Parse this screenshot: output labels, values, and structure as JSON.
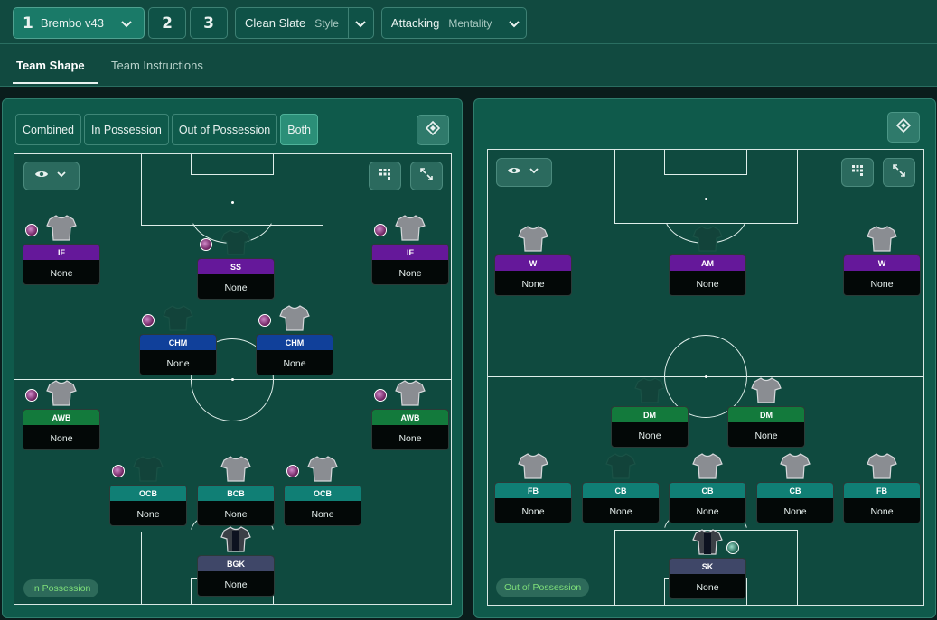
{
  "header": {
    "tactic": {
      "number": "1",
      "name": "Brembo v43"
    },
    "slots": [
      "2",
      "3"
    ],
    "style": {
      "value": "Clean Slate",
      "label": "Style"
    },
    "mentality": {
      "value": "Attacking",
      "label": "Mentality"
    },
    "tabs": [
      "Team Shape",
      "Team Instructions"
    ]
  },
  "left_panel": {
    "filters": [
      "Combined",
      "In Possession",
      "Out of Possession",
      "Both"
    ],
    "phase_label": "In Possession",
    "players": [
      {
        "role": "IF",
        "name": "None",
        "color": "purple"
      },
      {
        "role": "SS",
        "name": "None",
        "color": "purple"
      },
      {
        "role": "IF",
        "name": "None",
        "color": "purple"
      },
      {
        "role": "CHM",
        "name": "None",
        "color": "blue"
      },
      {
        "role": "CHM",
        "name": "None",
        "color": "blue"
      },
      {
        "role": "AWB",
        "name": "None",
        "color": "green"
      },
      {
        "role": "AWB",
        "name": "None",
        "color": "green"
      },
      {
        "role": "OCB",
        "name": "None",
        "color": "teal"
      },
      {
        "role": "BCB",
        "name": "None",
        "color": "teal"
      },
      {
        "role": "OCB",
        "name": "None",
        "color": "teal"
      },
      {
        "role": "BGK",
        "name": "None",
        "color": "slate"
      }
    ]
  },
  "right_panel": {
    "phase_label": "Out of Possession",
    "players": [
      {
        "role": "W",
        "name": "None",
        "color": "purple"
      },
      {
        "role": "AM",
        "name": "None",
        "color": "purple"
      },
      {
        "role": "W",
        "name": "None",
        "color": "purple"
      },
      {
        "role": "DM",
        "name": "None",
        "color": "green"
      },
      {
        "role": "DM",
        "name": "None",
        "color": "green"
      },
      {
        "role": "FB",
        "name": "None",
        "color": "teal"
      },
      {
        "role": "CB",
        "name": "None",
        "color": "teal"
      },
      {
        "role": "CB",
        "name": "None",
        "color": "teal"
      },
      {
        "role": "CB",
        "name": "None",
        "color": "teal"
      },
      {
        "role": "FB",
        "name": "None",
        "color": "teal"
      },
      {
        "role": "SK",
        "name": "None",
        "color": "slate"
      }
    ]
  },
  "icons": {
    "view": "eye-icon",
    "chevron": "chevron-down-icon",
    "grid": "grid-icon",
    "expand": "expand-icon",
    "tactics_board": "tactics-board-icon",
    "shirt": "shirt-icon",
    "ball": "ball-icon"
  },
  "colors": {
    "purple": "#65189a",
    "blue": "#10409a",
    "teal": "#107f75",
    "green": "#137a3c",
    "slate": "#3f4768",
    "panel": "#0f5a4b",
    "pitch": "#0f4a3f"
  }
}
